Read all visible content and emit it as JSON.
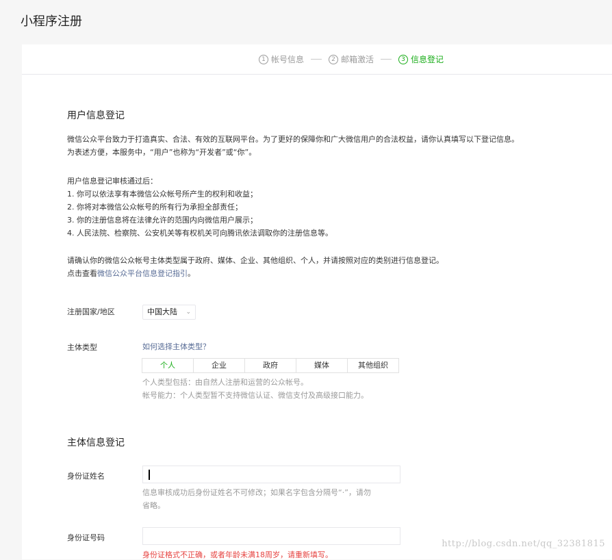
{
  "page_title": "小程序注册",
  "steps": [
    {
      "num": "1",
      "label": "帐号信息",
      "active": false
    },
    {
      "num": "2",
      "label": "邮箱激活",
      "active": false
    },
    {
      "num": "3",
      "label": "信息登记",
      "active": true
    }
  ],
  "user_info": {
    "title": "用户信息登记",
    "intro": [
      "微信公众平台致力于打造真实、合法、有效的互联网平台。为了更好的保障你和广大微信用户的合法权益，请你认真填写以下登记信息。",
      "为表述方便，本服务中，“用户”也称为“开发者”或“你”。"
    ],
    "after_title": "用户信息登记审核通过后：",
    "after_items": [
      "1. 你可以依法享有本微信公众帐号所产生的权利和收益；",
      "2. 你将对本微信公众帐号的所有行为承担全部责任；",
      "3. 你的注册信息将在法律允许的范围内向微信用户展示；",
      "4. 人民法院、检察院、公安机关等有权机关可向腾讯依法调取你的注册信息等。"
    ],
    "confirm_text": "请确认你的微信公众帐号主体类型属于政府、媒体、企业、其他组织、个人，并请按照对应的类别进行信息登记。",
    "guide_prefix": "点击查看",
    "guide_link": "微信公众平台信息登记指引",
    "guide_suffix": "。"
  },
  "country": {
    "label": "注册国家/地区",
    "value": "中国大陆"
  },
  "subject_type": {
    "label": "主体类型",
    "help_link": "如何选择主体类型？",
    "tabs": [
      "个人",
      "企业",
      "政府",
      "媒体",
      "其他组织"
    ],
    "selected": "个人",
    "hints": [
      "个人类型包括：由自然人注册和运营的公众帐号。",
      "帐号能力：个人类型暂不支持微信认证、微信支付及高级接口能力。"
    ]
  },
  "subject_info": {
    "title": "主体信息登记",
    "id_name": {
      "label": "身份证姓名",
      "value": "",
      "hint": [
        "信息审核成功后身份证姓名不可修改；如果名字包含分隔号“·”，请勿",
        "省略。"
      ]
    },
    "id_number": {
      "label": "身份证号码",
      "value": "",
      "error": "身份证格式不正确，或者年龄未满18周岁，请重新填写。"
    }
  },
  "watermark": "http://blog.csdn.net/qq_32381815",
  "colors": {
    "accent": "#1aad19",
    "link": "#576b95",
    "error": "#e64340"
  }
}
